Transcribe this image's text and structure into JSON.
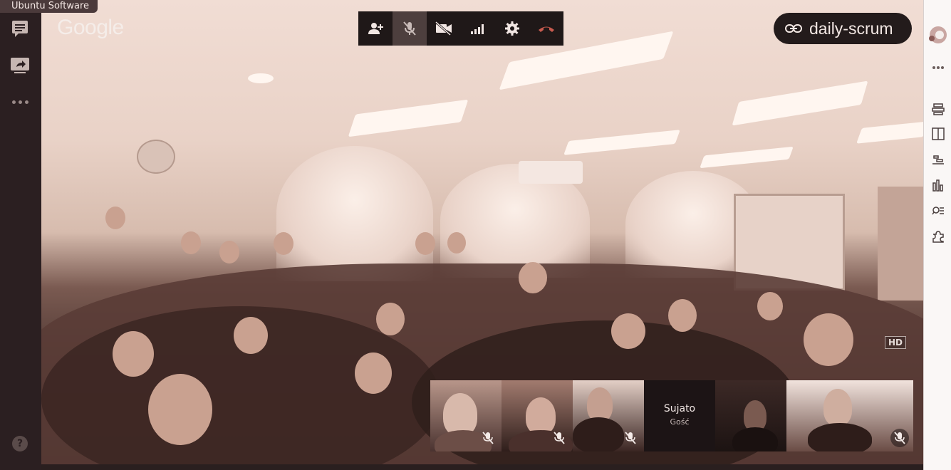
{
  "app_tooltip": "Ubuntu Software",
  "brand": "Google",
  "meeting": {
    "name": "daily-scrum"
  },
  "main_video": {
    "quality_badge": "HD"
  },
  "controls": {
    "add_person": "add-person",
    "mic": "mic-off",
    "camera": "camera-off",
    "signal": "signal",
    "settings": "settings",
    "hangup": "hang-up"
  },
  "participants": [
    {
      "id": "p1",
      "muted": true
    },
    {
      "id": "p2",
      "muted": true
    },
    {
      "id": "p3",
      "muted": true
    },
    {
      "id": "p4",
      "name": "Sujato",
      "role": "Gość",
      "muted": false
    },
    {
      "id": "p5",
      "muted": false
    },
    {
      "id": "p6",
      "muted": true
    }
  ],
  "colors": {
    "bar_bg": "#1f1818",
    "hangup": "#c95b4f",
    "tint": "#c9a190"
  }
}
